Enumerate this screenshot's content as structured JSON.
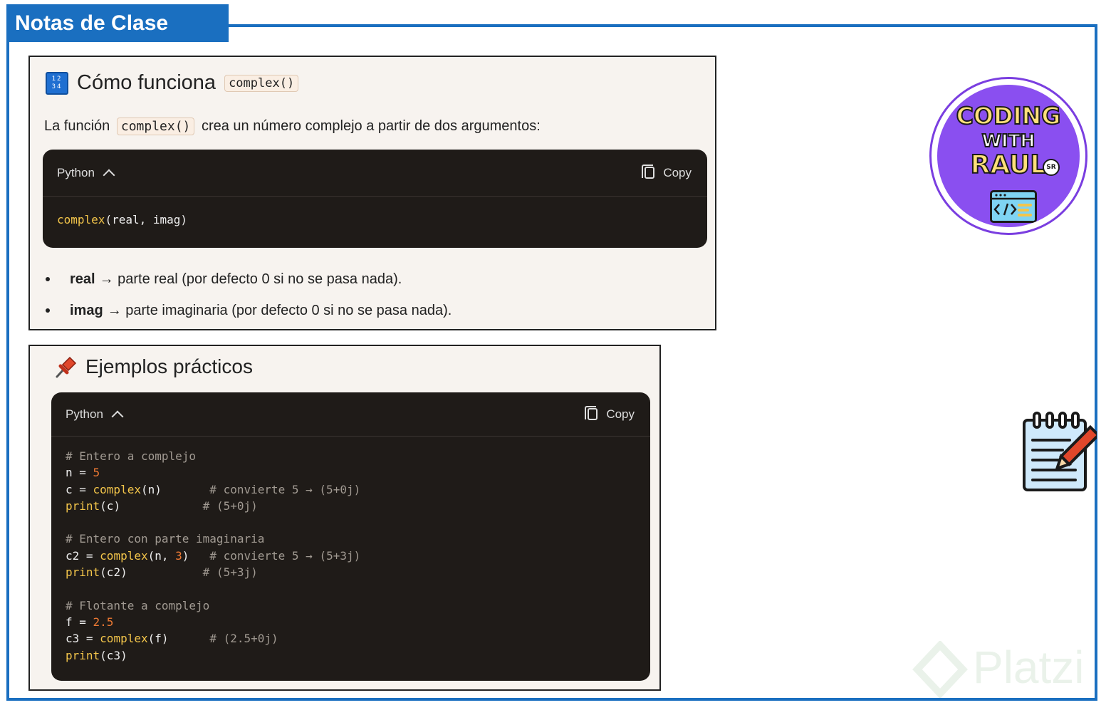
{
  "header": {
    "title": "Notas de Clase"
  },
  "section1": {
    "title": "Cómo funciona",
    "title_code": "complex()",
    "para_before": "La función",
    "para_code": "complex()",
    "para_after": "crea un número complejo a partir de dos argumentos:",
    "codeblock": {
      "lang": "Python",
      "copy_label": "Copy"
    },
    "bullets": [
      {
        "term": "real",
        "text": "→ parte real (por defecto 0 si no se pasa nada)."
      },
      {
        "term": "imag",
        "text": "→ parte imaginaria (por defecto 0 si no se pasa nada)."
      }
    ]
  },
  "section2": {
    "title": "Ejemplos prácticos",
    "codeblock": {
      "lang": "Python",
      "copy_label": "Copy"
    }
  },
  "logo": {
    "line1": "CODING",
    "line2": "WITH",
    "line3": "RAUL",
    "badge": "SR"
  },
  "watermark": {
    "text": "Platzi"
  },
  "colors": {
    "frame": "#1a6fc0",
    "code_bg": "#1f1b18",
    "keyword": "#f3c54a",
    "number": "#ef7a34",
    "comment": "#a19a92"
  }
}
